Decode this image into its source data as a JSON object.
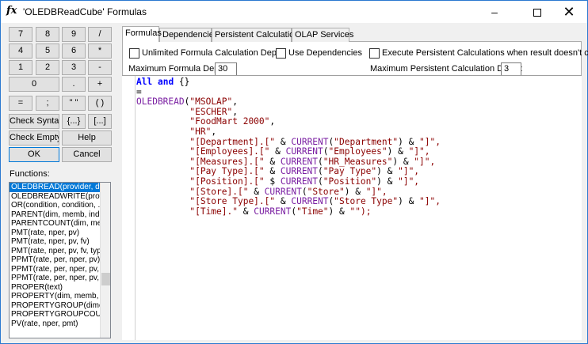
{
  "window": {
    "title": "'OLEDBReadCube' Formulas",
    "icon": "fx",
    "minimize": "–",
    "close": "✕"
  },
  "keypad": {
    "rows": [
      [
        "7",
        "8",
        "9",
        "/"
      ],
      [
        "4",
        "5",
        "6",
        "*"
      ],
      [
        "1",
        "2",
        "3",
        "-"
      ],
      [
        "0",
        ".",
        "+"
      ],
      [
        "=",
        ";",
        "\" \"",
        "( )"
      ]
    ]
  },
  "buttons": {
    "check_syntax": "Check Syntax",
    "braces": "{...}",
    "brackets": "[...]",
    "check_empty": "Check Empty",
    "help": "Help",
    "ok": "OK",
    "cancel": "Cancel"
  },
  "functions": {
    "label": "Functions:",
    "items": [
      "OLEDBREAD(provider, dat",
      "OLEDBREADWRITE(provi",
      "OR(condition, condition, ...",
      "PARENT(dim, memb, index",
      "PARENTCOUNT(dim, mem",
      "PMT(rate, nper, pv)",
      "PMT(rate, nper, pv, fv)",
      "PMT(rate, nper, pv, fv, type",
      "PPMT(rate, per, nper, pv)",
      "PPMT(rate, per, nper, pv, fv",
      "PPMT(rate, per, nper, pv, fv",
      "PROPER(text)",
      "PROPERTY(dim, memb, gr",
      "PROPERTYGROUP(dimen",
      "PROPERTYGROUPCOUN",
      "PV(rate, nper, pmt)"
    ],
    "selected_index": 0
  },
  "tabs": [
    "Formulas",
    "Dependencies",
    "Persistent Calculations",
    "OLAP Services"
  ],
  "active_tab": 0,
  "options": {
    "unlimited_depth": "Unlimited Formula Calculation Depth",
    "use_dependencies": "Use Dependencies",
    "execute_persistent": "Execute Persistent Calculations when result doesn't change",
    "max_depth_label": "Maximum Formula Depth:",
    "max_depth_value": "30",
    "max_persistent_label": "Maximum Persistent Calculation Depth:",
    "max_persistent_value": "3"
  },
  "code": {
    "line1_kw1": "All",
    "line1_kw2": "and",
    "line1_rest": " {}",
    "line2": "=",
    "fn": "OLEDBREAD",
    "current": "CURRENT",
    "args": [
      "\"MSOLAP\"",
      "\"ESCHER\"",
      "\"FoodMart 2000\"",
      "\"HR\""
    ],
    "dims": [
      {
        "pre": "\"[Department].[\"",
        "arg": "\"Department\"",
        "post": "\"]\","
      },
      {
        "pre": "\"[Employees].[\"",
        "arg": "\"Employees\"",
        "post": "\"]\","
      },
      {
        "pre": "\"[Measures].[\"",
        "arg": "\"HR_Measures\"",
        "post": "\"]\","
      },
      {
        "pre": "\"[Pay Type].[\"",
        "arg": "\"Pay Type\"",
        "post": "\"]\","
      },
      {
        "pre": "\"[Position].[\"",
        "arg": "\"Position\"",
        "post": "\"]\","
      },
      {
        "pre": "\"[Store].[\"",
        "arg": "\"Store\"",
        "post": "\"]\","
      },
      {
        "pre": "\"[Store Type].[\"",
        "arg": "\"Store Type\"",
        "post": "\"]\","
      }
    ],
    "last_pre": "\"[Time].\"",
    "last_arg": "\"Time\"",
    "last_post": "\"\");"
  }
}
